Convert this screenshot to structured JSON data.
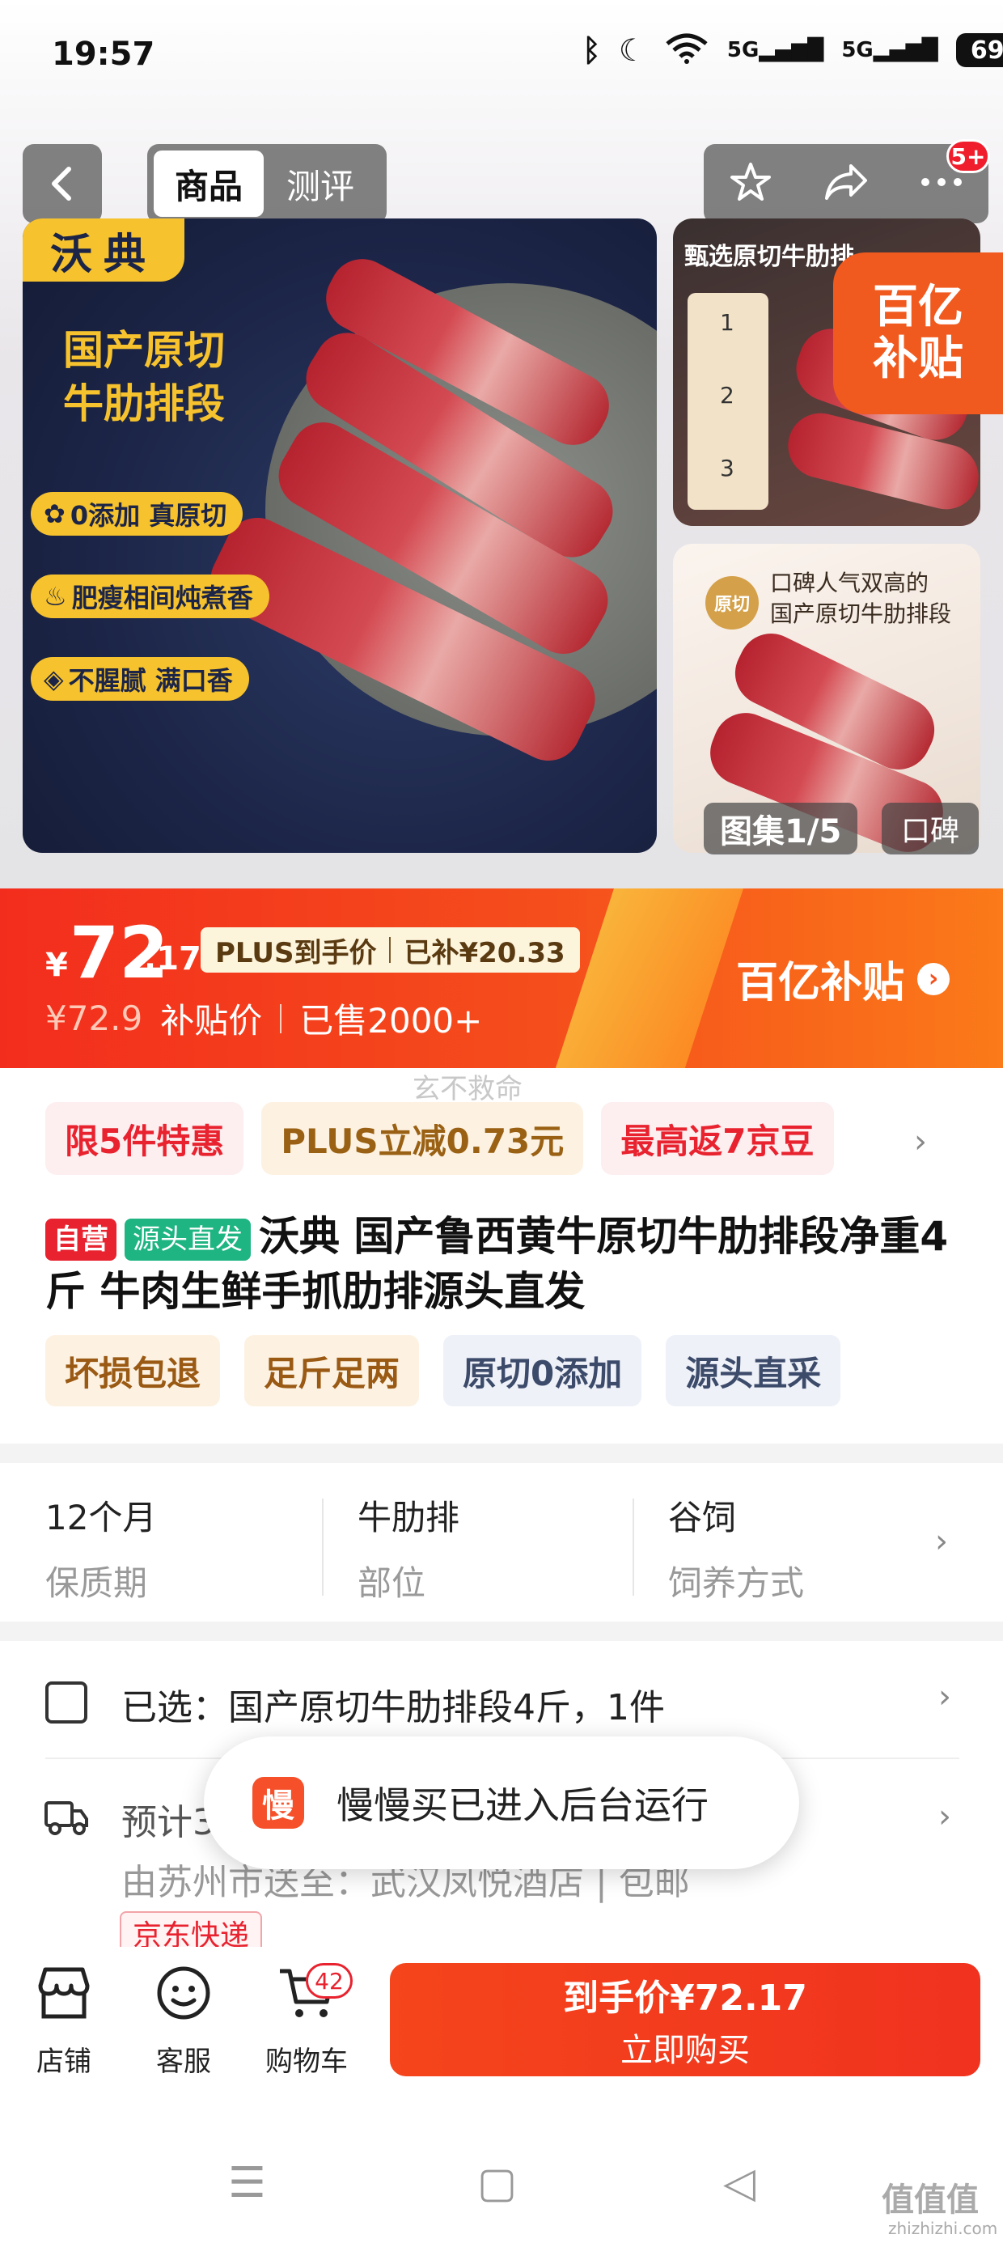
{
  "status_bar": {
    "time": "19:57",
    "battery": "69",
    "signal1": "5G",
    "signal2": "5G"
  },
  "nav": {
    "tabs": [
      {
        "label": "商品"
      },
      {
        "label": "测评"
      }
    ],
    "message_badge": "5+"
  },
  "gallery": {
    "main": {
      "brand": "沃典",
      "headline_line1": "国产原切",
      "headline_line2": "牛肋排段",
      "features": [
        "0添加 真原切",
        "肥瘦相间炖煮香",
        "不腥腻 满口香"
      ]
    },
    "side1": {
      "title": "甄选原切牛肋排",
      "steps": [
        "1",
        "2",
        "3"
      ]
    },
    "subsidy_badge": {
      "line1": "百亿",
      "line2": "补贴"
    },
    "side2": {
      "badge": "原切",
      "line1": "口碑人气双高的",
      "line2": "国产原切牛肋排段"
    },
    "counter": "图集1/5",
    "extra": "口碑"
  },
  "price": {
    "yen": "¥",
    "integer": "72",
    "decimal": ".17",
    "plus_label": "PLUS到手价",
    "plus_subsidy": "已补¥20.33",
    "original": "¥72.9",
    "subsidy_price_label": "补贴价",
    "sold": "已售2000+",
    "subsidy_logo": "百亿补贴",
    "colors": {
      "banner": "#f54e1c",
      "accent": "#e8232f"
    }
  },
  "watermark": "玄不救命",
  "promos": [
    {
      "label": "限5件特惠",
      "style": "red"
    },
    {
      "label": "PLUS立减0.73元",
      "style": "gold"
    },
    {
      "label": "最高返7京豆",
      "style": "red"
    }
  ],
  "product": {
    "tag_self": "自营",
    "tag_source": "源头直发",
    "title": "沃典 国产鲁西黄牛原切牛肋排段净重4斤 牛肉生鲜手抓肋排源头直发"
  },
  "services": [
    {
      "label": "坏损包退",
      "style": "warm"
    },
    {
      "label": "足斤足两",
      "style": "warm"
    },
    {
      "label": "原切0添加",
      "style": "cool"
    },
    {
      "label": "源头直采",
      "style": "cool"
    }
  ],
  "specs": [
    {
      "value": "12个月",
      "key": "保质期"
    },
    {
      "value": "牛肋排",
      "key": "部位"
    },
    {
      "value": "谷饲",
      "key": "饲养方式"
    }
  ],
  "selected": "已选：国产原切牛肋排段4斤，1件",
  "shipping": {
    "eta": "预计3",
    "from": "由苏州市送至：武汉凤悦酒店 | 包邮",
    "carrier": "京东快递"
  },
  "toast": {
    "icon": "慢",
    "text": "慢慢买已进入后台运行"
  },
  "bottom": {
    "items": [
      {
        "label": "店铺"
      },
      {
        "label": "客服"
      },
      {
        "label": "购物车"
      }
    ],
    "cart_count": "42",
    "buy_price": "到手价¥72.17",
    "buy_label": "立即购买"
  },
  "site": {
    "mark": "值值值",
    "url": "zhizhizhi.com"
  }
}
